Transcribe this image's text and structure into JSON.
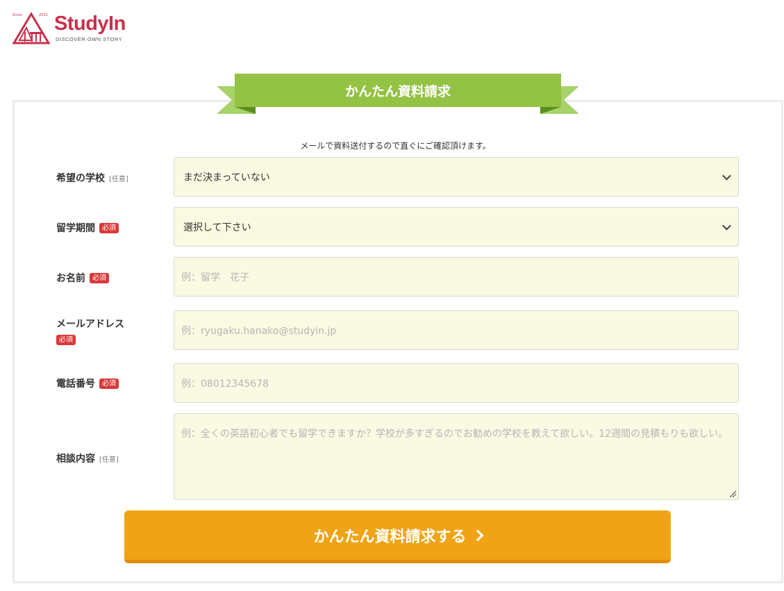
{
  "logo": {
    "since": "Since",
    "year": "2012",
    "name": "StudyIn",
    "tagline": "DISCOVER OWN STORY",
    "color": "#c8304a"
  },
  "ribbon": {
    "title": "かんたん資料請求"
  },
  "note": "メールで資料送付するので直ぐにご確認頂けます。",
  "form": {
    "school": {
      "label": "希望の学校",
      "tag": "[任意]",
      "value": "まだ決まっていない"
    },
    "period": {
      "label": "留学期間",
      "tag": "必須",
      "value": "選択して下さい"
    },
    "name": {
      "label": "お名前",
      "tag": "必須",
      "placeholder": "例：留学　花子"
    },
    "email": {
      "label": "メールアドレス",
      "tag": "必須",
      "placeholder": "例：ryugaku.hanako@studyin.jp"
    },
    "phone": {
      "label": "電話番号",
      "tag": "必須",
      "placeholder": "例：08012345678"
    },
    "message": {
      "label": "相談内容",
      "tag": "[任意]",
      "placeholder": "例：全くの英語初心者でも留学できますか？学校が多すぎるのでお勧めの学校を教えて欲しい。12週間の見積もりも欲しい。"
    }
  },
  "submit": {
    "label": "かんたん資料請求する"
  },
  "colors": {
    "ribbon": "#94c245",
    "field_bg": "#faf9e2",
    "required_badge": "#d9383a",
    "submit": "#f0a415"
  }
}
